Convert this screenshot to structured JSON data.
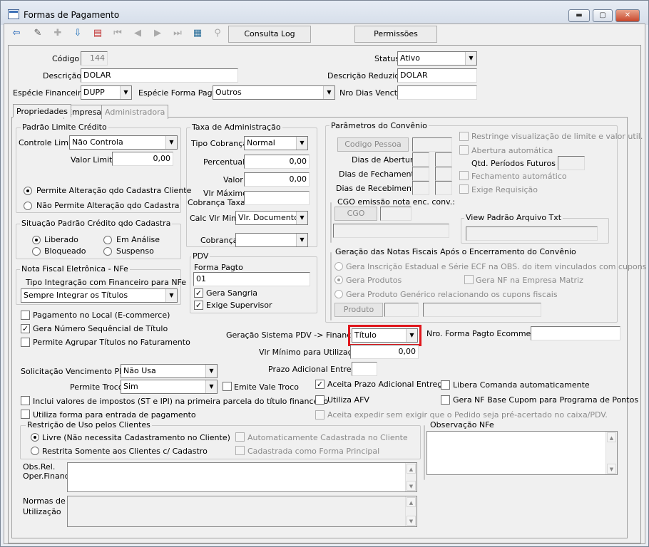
{
  "window": {
    "title": "Formas de Pagamento",
    "min": "▬",
    "max": "▢",
    "close": "✕"
  },
  "toolbar": {
    "consulta_log": "Consulta Log",
    "permissoes": "Permissões"
  },
  "header": {
    "codigo_label": "Código",
    "codigo_value": "144",
    "status_label": "Status",
    "status_value": "Ativo",
    "descricao_label": "Descrição",
    "descricao_value": "DOLAR",
    "descricao_reduzida_label": "Descrição Reduzida",
    "descricao_reduzida_value": "DOLAR",
    "especie_financeira_label": "Espécie Financeira",
    "especie_financeira_value": "DUPP",
    "especie_forma_pagto_label": "Espécie Forma Pagto",
    "especie_forma_pagto_value": "Outros",
    "nro_dias_vencto_label": "Nro Dias Vencto",
    "nro_dias_vencto_value": ""
  },
  "tabs": [
    "Propriedades",
    "Empresas",
    "Administradora"
  ],
  "padrao_limite": {
    "legend": "Padrão Limite Crédito",
    "controle_label": "Controle Limite",
    "controle_value": "Não Controla",
    "valor_label": "Valor Limite",
    "valor_value": "0,00",
    "opt1": "Permite Alteração qdo Cadastra Cliente",
    "opt2": "Não Permite Alteração qdo Cadastra"
  },
  "situacao": {
    "legend": "Situação Padrão Crédito qdo Cadastra",
    "liberado": "Liberado",
    "em_analise": "Em Análise",
    "bloqueado": "Bloqueado",
    "suspenso": "Suspenso"
  },
  "nfe": {
    "legend": "Nota Fiscal Eletrônica - NFe",
    "tipo_label": "Tipo Integração com Financeiro para NFe",
    "tipo_value": "Sempre Integrar os Títulos"
  },
  "checks_left": {
    "pagamento_local": "Pagamento no Local (E-commerce)",
    "gera_numero": "Gera Número Sequêncial de Título",
    "permite_agrupar": "Permite Agrupar Títulos no Faturamento"
  },
  "taxa": {
    "legend": "Taxa de Administração",
    "tipo_cobranca_label": "Tipo Cobrança",
    "tipo_cobranca_value": "Normal",
    "percentual_label": "Percentual",
    "percentual_value": "0,00",
    "valor_label": "Valor",
    "valor_value": "0,00",
    "vlr_max_label1": "Vlr Máximo",
    "vlr_max_label2": "Cobrança Taxa",
    "calc_label": "Calc Vlr Min",
    "calc_value": "Vlr. Documento",
    "cobranca_label": "Cobrança"
  },
  "pdv": {
    "legend": "PDV",
    "forma_pagto_label": "Forma Pagto",
    "forma_pagto_value": "01",
    "gera_sangria": "Gera Sangria",
    "exige_supervisor": "Exige Supervisor"
  },
  "convenio": {
    "legend": "Parâmetros do Convênio",
    "codigo_pessoa": "Codigo Pessoa",
    "dias_abertura": "Dias de Abertura",
    "dias_fechamento": "Dias de Fechamento",
    "dias_recebimento": "Dias de Recebimento",
    "restringe": "Restringe visualização de limite e valor util.",
    "abertura_auto": "Abertura automática",
    "qtd_periodos": "Qtd. Períodos Futuros",
    "fechamento_auto": "Fechamento automático",
    "exige_requisicao": "Exige Requisição",
    "cgo_legend": "CGO emissão nota enc. conv.:",
    "cgo_button": "CGO",
    "view_legend": "View Padrão Arquivo Txt"
  },
  "geracao_notas": {
    "legend": "Geração das Notas Fiscais Após o Encerramento do Convênio",
    "opt1": "Gera Inscrição Estadual e Série ECF na OBS. do item vinculados com cupons",
    "opt2": "Gera Produtos",
    "opt2b": "Gera NF na Empresa Matriz",
    "opt3": "Gera Produto Genérico relacionando os cupons fiscais",
    "produto_button": "Produto"
  },
  "geracao_pdv": {
    "label": "Geração Sistema PDV -> Financeiro",
    "value": "Título",
    "nro_forma_label": "Nro. Forma Pagto Ecommerce",
    "nro_forma_value": "",
    "vlr_minimo_label": "Vlr Mínimo para Utilização",
    "vlr_minimo_value": "0,00",
    "prazo_label": "Prazo Adicional Entrega",
    "prazo_value": ""
  },
  "solicitacao": {
    "label": "Solicitação Vencimento PDV",
    "value": "Não Usa",
    "permite_troco_label": "Permite Troco",
    "permite_troco_value": "Sim",
    "emite_vale_troco": "Emite Vale Troco"
  },
  "checks_bottom": {
    "inclui_impostos": "Inclui valores de impostos (ST e IPI) na primeira parcela do título financeiro",
    "utiliza_forma": "Utiliza forma para entrada de pagamento",
    "aceita_prazo": "Aceita Prazo Adicional Entrega",
    "libera_comanda": "Libera Comanda automaticamente",
    "utiliza_afv": "Utiliza AFV",
    "gera_nf_base": "Gera NF Base Cupom para Programa de Pontos",
    "aceita_expedir": "Aceita expedir sem exigir que o Pedido seja pré-acertado no caixa/PDV."
  },
  "restricao": {
    "legend": "Restrição de Uso pelos Clientes",
    "livre": "Livre (Não necessita Cadastramento no Cliente)",
    "restrita": "Restrita Somente aos Clientes c/ Cadastro",
    "auto_cadastrada": "Automaticamente Cadastrada no Cliente",
    "cadastrada_principal": "Cadastrada como Forma Principal"
  },
  "observacao": {
    "legend": "Observação NFe"
  },
  "obs_rel": {
    "label1": "Obs.Rel.",
    "label2": "Oper.Financ."
  },
  "normas": {
    "label1": "Normas de",
    "label2": "Utilização"
  },
  "colors": {
    "highlight": "#e0161c"
  }
}
